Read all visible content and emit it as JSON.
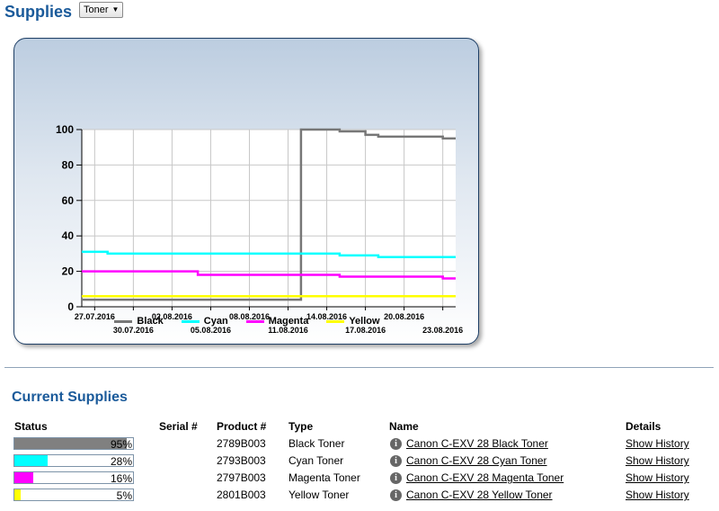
{
  "header": {
    "title": "Supplies",
    "selected_supply": "Toner"
  },
  "chart_data": {
    "type": "line",
    "title": "",
    "xlabel": "",
    "ylabel": "",
    "ylim": [
      0,
      100
    ],
    "yticks": [
      0,
      20,
      40,
      60,
      80,
      100
    ],
    "xlim": [
      "2016-07-26",
      "2016-08-24"
    ],
    "xtick_labels": [
      "27.07.2016",
      "30.07.2016",
      "02.08.2016",
      "05.08.2016",
      "08.08.2016",
      "11.08.2016",
      "14.08.2016",
      "17.08.2016",
      "20.08.2016",
      "23.08.2016"
    ],
    "xtick_dates": [
      "2016-07-27",
      "2016-07-30",
      "2016-08-02",
      "2016-08-05",
      "2016-08-08",
      "2016-08-11",
      "2016-08-14",
      "2016-08-17",
      "2016-08-20",
      "2016-08-23"
    ],
    "grid": true,
    "legend": "bottom",
    "series": [
      {
        "name": "Black",
        "color": "#777777",
        "points": [
          [
            "2016-07-26",
            4
          ],
          [
            "2016-08-12",
            4
          ],
          [
            "2016-08-12",
            100
          ],
          [
            "2016-08-15",
            100
          ],
          [
            "2016-08-15",
            99
          ],
          [
            "2016-08-17",
            99
          ],
          [
            "2016-08-17",
            97
          ],
          [
            "2016-08-18",
            97
          ],
          [
            "2016-08-18",
            96
          ],
          [
            "2016-08-23",
            96
          ],
          [
            "2016-08-23",
            95
          ],
          [
            "2016-08-24",
            95
          ]
        ]
      },
      {
        "name": "Cyan",
        "color": "#00ffff",
        "points": [
          [
            "2016-07-26",
            31
          ],
          [
            "2016-07-28",
            31
          ],
          [
            "2016-07-28",
            30
          ],
          [
            "2016-08-15",
            30
          ],
          [
            "2016-08-15",
            29
          ],
          [
            "2016-08-18",
            29
          ],
          [
            "2016-08-18",
            28
          ],
          [
            "2016-08-24",
            28
          ]
        ]
      },
      {
        "name": "Magenta",
        "color": "#ff00ff",
        "points": [
          [
            "2016-07-26",
            20
          ],
          [
            "2016-08-04",
            20
          ],
          [
            "2016-08-04",
            18
          ],
          [
            "2016-08-15",
            18
          ],
          [
            "2016-08-15",
            17
          ],
          [
            "2016-08-23",
            17
          ],
          [
            "2016-08-23",
            16
          ],
          [
            "2016-08-24",
            16
          ]
        ]
      },
      {
        "name": "Yellow",
        "color": "#ffff00",
        "points": [
          [
            "2016-07-26",
            6
          ],
          [
            "2016-08-24",
            6
          ]
        ]
      }
    ]
  },
  "current_supplies": {
    "title": "Current Supplies",
    "columns": {
      "status": "Status",
      "serial": "Serial #",
      "product": "Product #",
      "type": "Type",
      "name": "Name",
      "details": "Details"
    },
    "rows": [
      {
        "level": 95,
        "level_text": "95%",
        "color": "#808080",
        "serial": "",
        "product": "2789B003",
        "type": "Black Toner",
        "name": "Canon C-EXV 28 Black Toner",
        "details": "Show History"
      },
      {
        "level": 28,
        "level_text": "28%",
        "color": "#00ffff",
        "serial": "",
        "product": "2793B003",
        "type": "Cyan Toner",
        "name": "Canon C-EXV 28 Cyan Toner",
        "details": "Show History"
      },
      {
        "level": 16,
        "level_text": "16%",
        "color": "#ff00ff",
        "serial": "",
        "product": "2797B003",
        "type": "Magenta Toner",
        "name": "Canon C-EXV 28 Magenta Toner",
        "details": "Show History"
      },
      {
        "level": 5,
        "level_text": "5%",
        "color": "#ffff00",
        "serial": "",
        "product": "2801B003",
        "type": "Yellow Toner",
        "name": "Canon C-EXV 28 Yellow Toner",
        "details": "Show History"
      }
    ]
  }
}
